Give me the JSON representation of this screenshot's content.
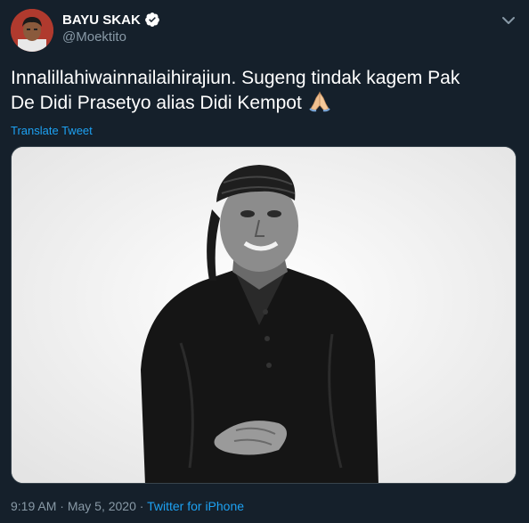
{
  "author": {
    "display_name": "BAYU SKAK",
    "handle": "@Moektito",
    "verified": true,
    "avatar_icon": "profile-avatar"
  },
  "tweet": {
    "text_line1": "Innalillahiwainnailaihirajiun. Sugeng tindak kagem Pak",
    "text_line2": "De Didi Prasetyo alias Didi Kempot",
    "emoji": "folded-hands",
    "translate_label": "Translate Tweet"
  },
  "media": {
    "type": "black-and-white portrait photo"
  },
  "meta": {
    "time": "9:19 AM",
    "separator": "·",
    "date": "May 5, 2020",
    "source": "Twitter for iPhone"
  },
  "colors": {
    "background": "#15202b",
    "text": "#ffffff",
    "secondary": "#8899a6",
    "accent": "#1da1f2"
  }
}
